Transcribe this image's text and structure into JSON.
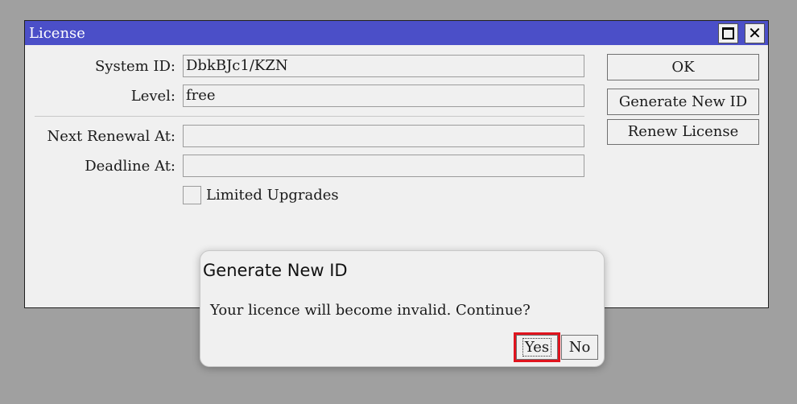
{
  "colors": {
    "titlebar_background": "#4b4fc8",
    "highlight_outline": "#e0141e"
  },
  "window": {
    "title": "License",
    "maximize_icon": "maximize-icon",
    "close_icon": "close-icon",
    "close_glyph": "✕"
  },
  "form": {
    "system_id_label": "System ID:",
    "system_id_value": "DbkBJc1/KZN",
    "level_label": "Level:",
    "level_value": "free",
    "next_renewal_label": "Next Renewal At:",
    "next_renewal_value": "",
    "deadline_label": "Deadline At:",
    "deadline_value": "",
    "limited_upgrades_label": "Limited Upgrades",
    "limited_upgrades_checked": false
  },
  "buttons": {
    "ok": "OK",
    "generate_new_id": "Generate New ID",
    "renew_license": "Renew License"
  },
  "dialog": {
    "title": "Generate New ID",
    "message": "Your licence will become invalid. Continue?",
    "yes": "Yes",
    "no": "No"
  }
}
